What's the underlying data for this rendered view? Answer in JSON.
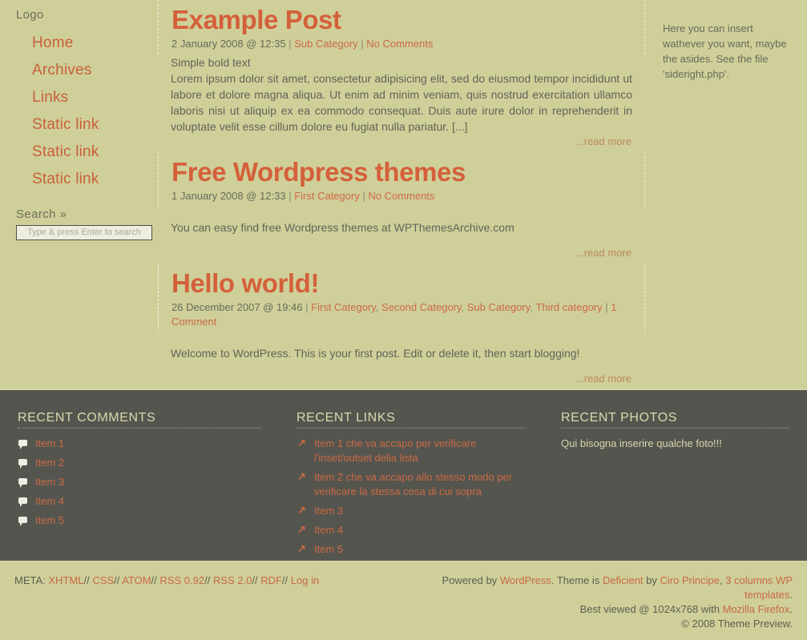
{
  "site": {
    "logo": "Logo",
    "bg_color": "#cfcf99",
    "accent_color": "#c9603a",
    "footer_bg": "#55554f"
  },
  "sidebar_left": {
    "nav": [
      {
        "label": "Home"
      },
      {
        "label": "Archives"
      },
      {
        "label": "Links"
      },
      {
        "label": "Static link"
      },
      {
        "label": "Static link"
      },
      {
        "label": "Static link"
      }
    ],
    "search": {
      "title": "Search »",
      "placeholder": "Type & press Enter to search",
      "value": ""
    }
  },
  "posts": [
    {
      "title": "Example Post",
      "date": "2 January 2008 @ 12:35",
      "categories": [
        "Sub Category"
      ],
      "comments": "No Comments",
      "bold_line": "Simple bold text",
      "body": "Lorem ipsum dolor sit amet, consectetur adipisicing elit, sed do eiusmod tempor incididunt ut labore et dolore magna aliqua. Ut enim ad minim veniam, quis nostrud exercitation ullamco laboris nisi ut aliquip ex ea commodo consequat. Duis aute irure dolor in reprehenderit in voluptate velit esse cillum dolore eu fugiat nulla pariatur. [...]",
      "readmore": "...read more"
    },
    {
      "title": "Free Wordpress themes",
      "date": "1 January 2008 @ 12:33",
      "categories": [
        "First Category"
      ],
      "comments": "No Comments",
      "bold_line": "",
      "body": "You can easy find free Wordpress themes at WPThemesArchive.com",
      "readmore": "...read more"
    },
    {
      "title": "Hello world!",
      "date": "26 December 2007 @ 19:46",
      "categories": [
        "First Category",
        "Second Category",
        "Sub Category",
        "Third category"
      ],
      "comments": "1 Comment",
      "bold_line": "",
      "body": "Welcome to WordPress. This is your first post. Edit or delete it, then start blogging!",
      "readmore": "...read more"
    }
  ],
  "sidebar_right": {
    "text": "Here you can insert wathever you want, maybe the asides. See the file 'sideright.php'."
  },
  "footer_widgets": {
    "recent_comments": {
      "title": "RECENT COMMENTS",
      "items": [
        "Item 1",
        "Item 2",
        "Item 3",
        "Item 4",
        "Item 5"
      ]
    },
    "recent_links": {
      "title": "RECENT LINKS",
      "items": [
        "Item 1 che va accapo per verificare l'inset/outset della lista",
        "Item 2 che va accapo allo stesso modo per verificare la stessa cosa di cui sopra",
        "Item 3",
        "Item 4",
        "Item 5"
      ]
    },
    "recent_photos": {
      "title": "RECENT PHOTOS",
      "text": "Qui bisogna inserire qualche foto!!!"
    }
  },
  "footer_meta": {
    "label": "META:",
    "links": [
      "XHTML",
      "CSS",
      "ATOM",
      "RSS 0.92",
      "RSS 2.0",
      "RDF",
      "Log in"
    ],
    "separator": "//",
    "credits": {
      "powered_prefix": "Powered by",
      "wordpress": "WordPress",
      "theme_prefix": ". Theme is",
      "theme_name": "Deficient",
      "by": "by",
      "author": "Ciro Principe",
      "comma": ",",
      "templates": "3 columns WP templates",
      "period": ".",
      "bestviewed_prefix": "Best viewed @ 1024x768 with",
      "browser": "Mozilla Firefox",
      "bestviewed_suffix": ".",
      "copyright": "© 2008 Theme Preview."
    }
  }
}
